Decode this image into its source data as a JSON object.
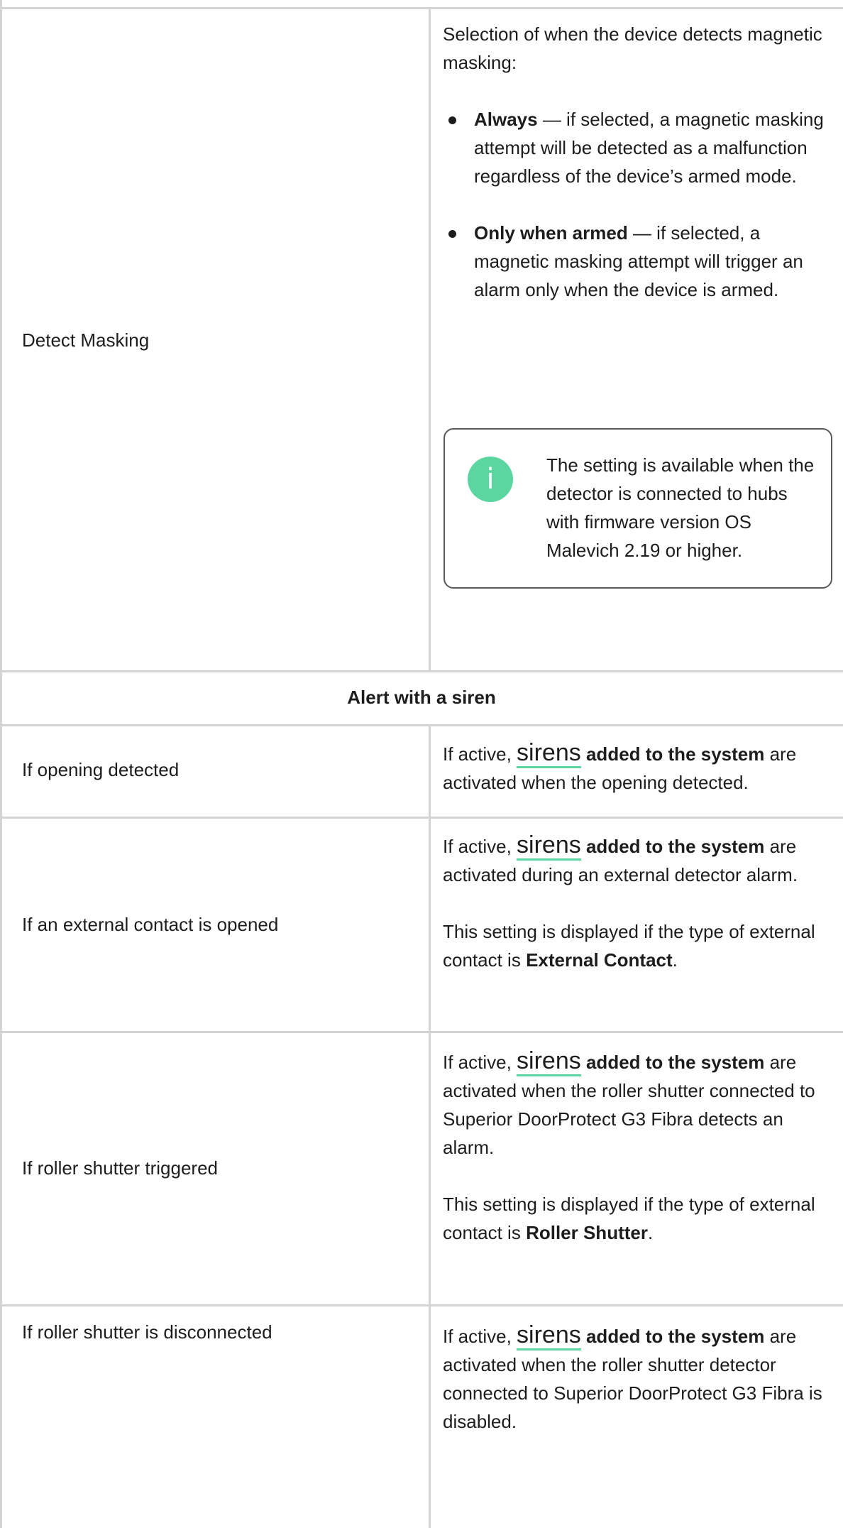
{
  "rows": [
    {
      "label": "Detect Masking",
      "intro": "Selection of when the device detects magnetic masking:",
      "options": [
        {
          "term": "Always",
          "text": " — if selected, a magnetic masking attempt will be detected as a malfunction regardless of the device’s armed mode."
        },
        {
          "term": "Only when armed",
          "text": " — if selected, a magnetic masking attempt will trigger an alarm only when the device is armed."
        }
      ],
      "note": {
        "icon": "info-icon",
        "icon_glyph": "i",
        "text": "The setting is available when the detector is connected to hubs with firmware version OS Malevich 2.19 or higher."
      }
    }
  ],
  "section": {
    "title": "Alert with a siren"
  },
  "siren_rows": [
    {
      "label": "If opening detected",
      "pre": "If active, ",
      "link": "sirens",
      "bold": " added to the system",
      "post": " are activated when the opening detected."
    },
    {
      "label": "If an external contact is opened",
      "pre": "If active, ",
      "link": "sirens",
      "bold": " added to the system",
      "post": " are activated during an external detector alarm.",
      "extra_pre": "This setting is displayed if the type of external contact is ",
      "extra_bold": "External Contact",
      "extra_post": "."
    },
    {
      "label": "If roller shutter triggered",
      "pre": "If active, ",
      "link": "sirens",
      "bold": " added to the system",
      "post": " are activated when the roller shutter connected to Superior DoorProtect G3 Fibra detects an alarm.",
      "extra_pre": "This setting is displayed if the type of external contact is ",
      "extra_bold": "Roller Shutter",
      "extra_post": "."
    },
    {
      "label": "If roller shutter is disconnected",
      "pre": "If active, ",
      "link": "sirens",
      "bold": " added to the system",
      "post": " are activated when the roller shutter detector connected to Superior DoorProtect G3 Fibra is disabled."
    }
  ],
  "colors": {
    "accent": "#5bd6a0",
    "border": "#d4d4d4",
    "text": "#1d1d1d"
  }
}
